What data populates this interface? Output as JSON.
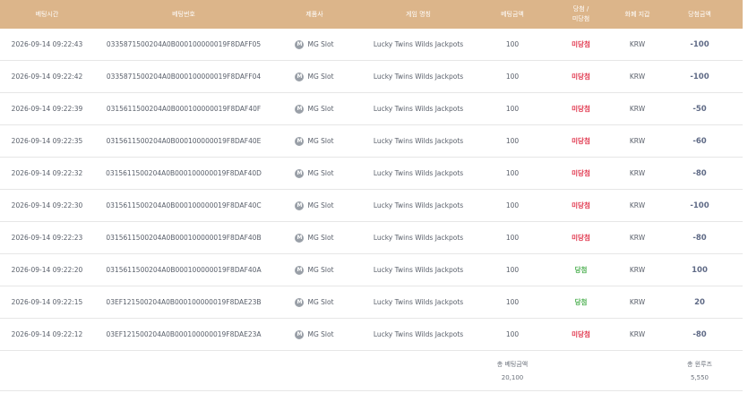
{
  "headers": [
    "베팅시간",
    "베팅번호",
    "제품사",
    "게임 명칭",
    "베팅금액",
    "당첨 /\n미당첨",
    "화폐 지갑",
    "당첨금액"
  ],
  "rows": [
    {
      "time": "2026-09-14 09:22:43",
      "id": "0335871500204A0B000100000019F8DAFF05",
      "provider": "MG Slot",
      "game": "Lucky Twins Wilds Jackpots",
      "bet": "100",
      "result": "미당첨",
      "status": "lose",
      "currency": "KRW",
      "payout": "-100"
    },
    {
      "time": "2026-09-14 09:22:42",
      "id": "0335871500204A0B000100000019F8DAFF04",
      "provider": "MG Slot",
      "game": "Lucky Twins Wilds Jackpots",
      "bet": "100",
      "result": "미당첨",
      "status": "lose",
      "currency": "KRW",
      "payout": "-100"
    },
    {
      "time": "2026-09-14 09:22:39",
      "id": "0315611500204A0B000100000019F8DAF40F",
      "provider": "MG Slot",
      "game": "Lucky Twins Wilds Jackpots",
      "bet": "100",
      "result": "미당첨",
      "status": "lose",
      "currency": "KRW",
      "payout": "-50"
    },
    {
      "time": "2026-09-14 09:22:35",
      "id": "0315611500204A0B000100000019F8DAF40E",
      "provider": "MG Slot",
      "game": "Lucky Twins Wilds Jackpots",
      "bet": "100",
      "result": "미당첨",
      "status": "lose",
      "currency": "KRW",
      "payout": "-60"
    },
    {
      "time": "2026-09-14 09:22:32",
      "id": "0315611500204A0B000100000019F8DAF40D",
      "provider": "MG Slot",
      "game": "Lucky Twins Wilds Jackpots",
      "bet": "100",
      "result": "미당첨",
      "status": "lose",
      "currency": "KRW",
      "payout": "-80"
    },
    {
      "time": "2026-09-14 09:22:30",
      "id": "0315611500204A0B000100000019F8DAF40C",
      "provider": "MG Slot",
      "game": "Lucky Twins Wilds Jackpots",
      "bet": "100",
      "result": "미당첨",
      "status": "lose",
      "currency": "KRW",
      "payout": "-100"
    },
    {
      "time": "2026-09-14 09:22:23",
      "id": "0315611500204A0B000100000019F8DAF40B",
      "provider": "MG Slot",
      "game": "Lucky Twins Wilds Jackpots",
      "bet": "100",
      "result": "미당첨",
      "status": "lose",
      "currency": "KRW",
      "payout": "-80"
    },
    {
      "time": "2026-09-14 09:22:20",
      "id": "0315611500204A0B000100000019F8DAF40A",
      "provider": "MG Slot",
      "game": "Lucky Twins Wilds Jackpots",
      "bet": "100",
      "result": "당첨",
      "status": "win",
      "currency": "KRW",
      "payout": "100"
    },
    {
      "time": "2026-09-14 09:22:15",
      "id": "03EF121500204A0B000100000019F8DAE23B",
      "provider": "MG Slot",
      "game": "Lucky Twins Wilds Jackpots",
      "bet": "100",
      "result": "당첨",
      "status": "win",
      "currency": "KRW",
      "payout": "20"
    },
    {
      "time": "2026-09-14 09:22:12",
      "id": "03EF121500204A0B000100000019F8DAE23A",
      "provider": "MG Slot",
      "game": "Lucky Twins Wilds Jackpots",
      "bet": "100",
      "result": "미당첨",
      "status": "lose",
      "currency": "KRW",
      "payout": "-80"
    }
  ],
  "footer": {
    "total_bet_label": "총 베팅금액",
    "total_bet": "20,100",
    "total_win_label": "총 윈루즈",
    "total_win": "5,550"
  },
  "icons": {
    "provider": "mg-provider-icon"
  },
  "colors": {
    "header_bg": "#dcb58a",
    "lose": "#e0344b",
    "win": "#4caf50",
    "payout": "#5f6a86"
  }
}
